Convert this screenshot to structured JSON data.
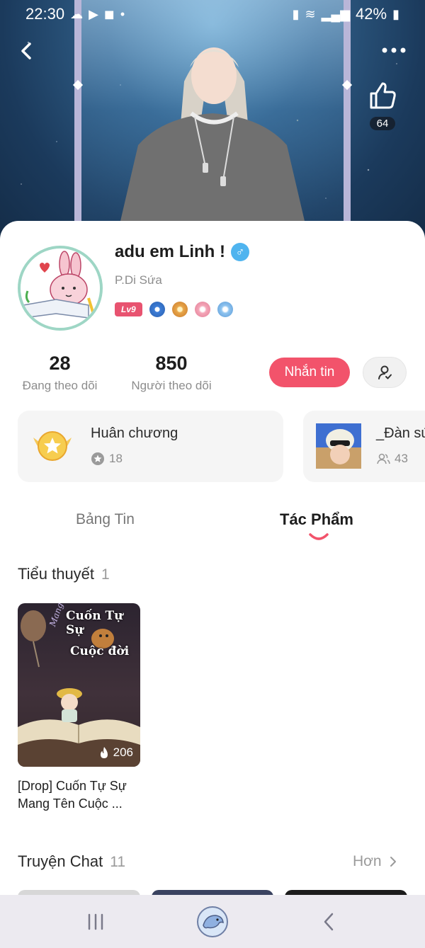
{
  "status_bar": {
    "time": "22:30",
    "battery": "42%"
  },
  "hero": {
    "like_count": "64"
  },
  "profile": {
    "name": "adu em Linh !",
    "gender_symbol": "♂",
    "handle": "P.Di Sứa",
    "level": "Lv9"
  },
  "stats": {
    "following_count": "28",
    "following_label": "Đang theo dõi",
    "followers_count": "850",
    "followers_label": "Người theo dõi"
  },
  "actions": {
    "message_label": "Nhắn tin"
  },
  "cards": {
    "medal": {
      "title": "Huân chương",
      "count": "18"
    },
    "group": {
      "title": "_Đàn sứa",
      "count": "43"
    }
  },
  "tabs": [
    {
      "label": "Bảng Tin",
      "active": false
    },
    {
      "label": "Tác Phẩm",
      "active": true
    }
  ],
  "novels": {
    "section_title": "Tiểu thuyết",
    "count": "1",
    "items": [
      {
        "cover_text_top": "Cuốn Tự Sự",
        "cover_text_side": "Mang tên",
        "cover_text_bottom": "Cuộc đời",
        "views": "206",
        "title": "[Drop] Cuốn Tự Sự Mang Tên Cuộc ..."
      }
    ]
  },
  "chats": {
    "section_title": "Truyện Chat",
    "count": "11",
    "more_label": "Hơn"
  },
  "colors": {
    "accent": "#f2536b",
    "level_badge": "#e85370",
    "gender": "#4fb4ef"
  }
}
